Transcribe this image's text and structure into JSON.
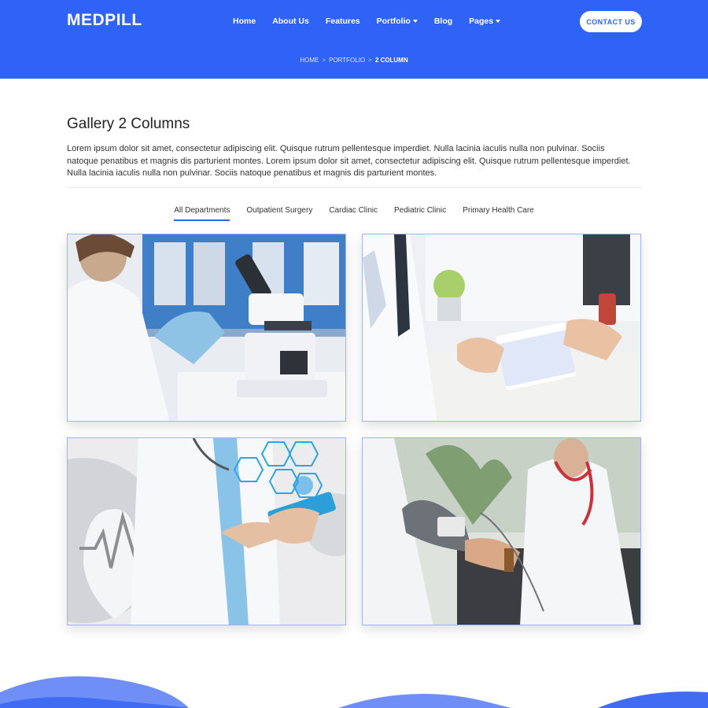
{
  "header": {
    "logo": "MEDPILL",
    "nav": [
      {
        "label": "Home",
        "dropdown": false
      },
      {
        "label": "About Us",
        "dropdown": false
      },
      {
        "label": "Features",
        "dropdown": false
      },
      {
        "label": "Portfolio",
        "dropdown": true
      },
      {
        "label": "Blog",
        "dropdown": false
      },
      {
        "label": "Pages",
        "dropdown": true
      }
    ],
    "contact_label": "CONTACT US",
    "accent_color": "#2f63f6"
  },
  "breadcrumb": {
    "items": [
      "HOME",
      "PORTFOLIO",
      "2 COLUMN"
    ],
    "separator": ">"
  },
  "main": {
    "title": "Gallery 2 Columns",
    "intro": "Lorem ipsum dolor sit amet, consectetur adipiscing elit. Quisque rutrum pellentesque imperdiet. Nulla lacinia iaculis nulla non pulvinar. Sociis natoque penatibus et magnis dis parturient montes. Lorem ipsum dolor sit amet, consectetur adipiscing elit. Quisque rutrum pellentesque imperdiet. Nulla lacinia iaculis nulla non pulvinar. Sociis natoque penatibus et magnis dis parturient montes.",
    "filters": [
      {
        "label": "All Departments",
        "active": true
      },
      {
        "label": "Outpatient Surgery",
        "active": false
      },
      {
        "label": "Cardiac Clinic",
        "active": false
      },
      {
        "label": "Pediatric Clinic",
        "active": false
      },
      {
        "label": "Primary Health Care",
        "active": false
      }
    ],
    "gallery": [
      {
        "subject": "lab-scientist-microscope"
      },
      {
        "subject": "doctor-writing-clipboard"
      },
      {
        "subject": "doctor-tablet-medical-icons"
      },
      {
        "subject": "doctor-blood-pressure-check"
      }
    ]
  }
}
